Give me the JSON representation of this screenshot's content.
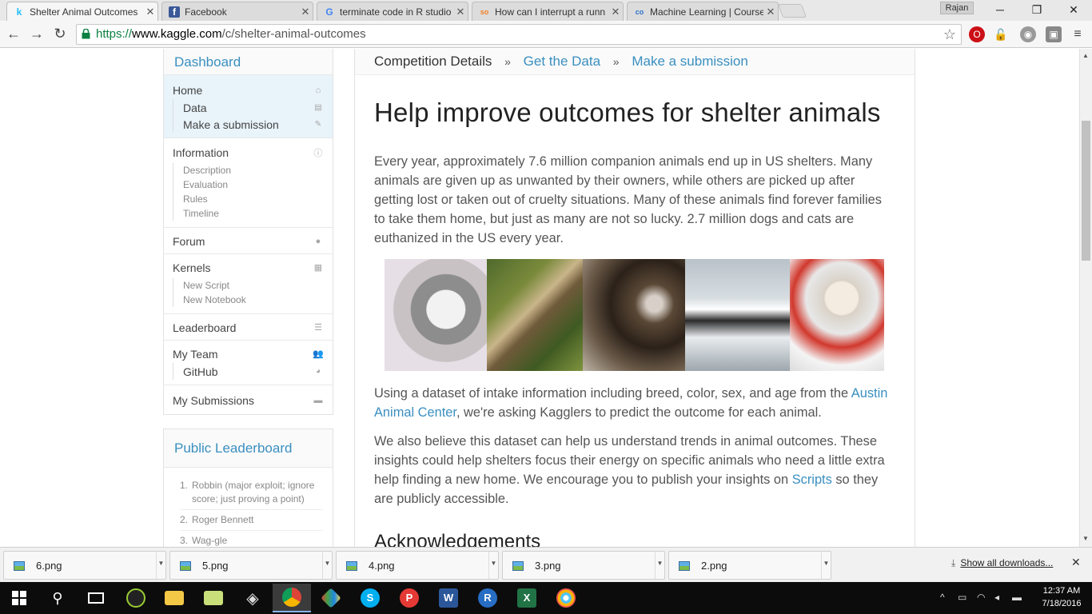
{
  "browser": {
    "tabs": [
      {
        "label": "Shelter Animal Outcomes",
        "favicon": "k",
        "active": true
      },
      {
        "label": "Facebook",
        "favicon": "f"
      },
      {
        "label": "terminate code in R studio",
        "favicon": "G"
      },
      {
        "label": "How can I interrupt a runn",
        "favicon": "so"
      },
      {
        "label": "Machine Learning | Course",
        "favicon": "co"
      }
    ],
    "profile_name": "Rajan",
    "url_scheme": "https://",
    "url_host": "www.kaggle.com",
    "url_path": "/c/shelter-animal-outcomes"
  },
  "sidebar": {
    "header": "Dashboard",
    "home": {
      "label": "Home",
      "subs": [
        {
          "label": "Data",
          "icon": "database-icon"
        },
        {
          "label": "Make a submission",
          "icon": "edit-icon"
        }
      ]
    },
    "information": {
      "label": "Information",
      "subs": [
        "Description",
        "Evaluation",
        "Rules",
        "Timeline"
      ]
    },
    "forum": "Forum",
    "kernels": {
      "label": "Kernels",
      "subs": [
        "New Script",
        "New Notebook"
      ]
    },
    "leaderboard": "Leaderboard",
    "my_team": {
      "label": "My Team",
      "subs": [
        "GitHub"
      ]
    },
    "my_submissions": "My Submissions"
  },
  "public_leaderboard": {
    "title": "Public Leaderboard",
    "entries": [
      {
        "rank": "1.",
        "name": "Robbin (major exploit; ignore score; just proving a point)"
      },
      {
        "rank": "2.",
        "name": "Roger Bennett"
      },
      {
        "rank": "3.",
        "name": "Wag-gle"
      }
    ]
  },
  "breadcrumb": {
    "current": "Competition Details",
    "separator": "»",
    "links": [
      "Get the Data",
      "Make a submission"
    ]
  },
  "article": {
    "title": "Help improve outcomes for shelter animals",
    "p1": "Every year, approximately 7.6 million companion animals end up in US shelters. Many animals are given up as unwanted by their owners, while others are picked up after getting lost or taken out of cruelty situations. Many of these animals find forever families to take them home, but just as many are not so lucky. 2.7 million dogs and cats are euthanized in the US every year.",
    "p2_before": "Using a dataset of intake information including breed, color, sex, and age from the ",
    "p2_link": "Austin Animal Center",
    "p2_after": ", we're asking Kagglers to predict the outcome for each animal.",
    "p3_before": "We also believe this dataset can help us understand trends in animal outcomes. These insights could help shelters focus their energy on specific animals who need a little extra help finding a new home. We encourage you to publish your insights on ",
    "p3_link": "Scripts",
    "p3_after": " so they are publicly accessible.",
    "next_heading": "Acknowledgements"
  },
  "downloads": {
    "files": [
      "6.png",
      "5.png",
      "4.png",
      "3.png",
      "2.png"
    ],
    "show_all": "Show all downloads..."
  },
  "taskbar": {
    "time": "12:37 AM",
    "date": "7/18/2016"
  }
}
